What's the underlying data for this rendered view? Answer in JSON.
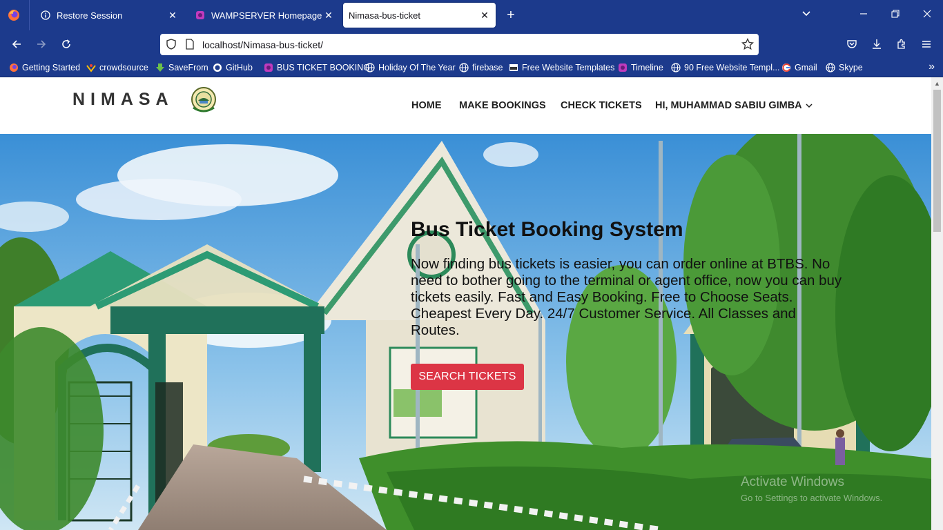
{
  "browser": {
    "tabs": [
      {
        "title": "Restore Session",
        "icon": "info-icon"
      },
      {
        "title": "WAMPSERVER Homepage",
        "icon": "wamp-icon"
      },
      {
        "title": "Nimasa-bus-ticket",
        "icon": "none"
      }
    ],
    "url": "localhost/Nimasa-bus-ticket/",
    "bookmarks": [
      {
        "label": "Getting Started",
        "icon": "firefox-icon"
      },
      {
        "label": "crowdsource",
        "icon": "crowdsource-icon"
      },
      {
        "label": "SaveFrom",
        "icon": "download-arrow-icon"
      },
      {
        "label": "GitHub",
        "icon": "github-icon"
      },
      {
        "label": "BUS TICKET BOOKING",
        "icon": "wamp-icon"
      },
      {
        "label": "Holiday Of The Year",
        "icon": "globe-icon"
      },
      {
        "label": "firebase",
        "icon": "globe-icon"
      },
      {
        "label": "Free Website Templates",
        "icon": "ost-icon"
      },
      {
        "label": "Timeline",
        "icon": "wamp-icon"
      },
      {
        "label": "90 Free Website Templ...",
        "icon": "globe-icon"
      },
      {
        "label": "Gmail",
        "icon": "google-icon"
      },
      {
        "label": "Skype",
        "icon": "globe-icon"
      }
    ]
  },
  "site": {
    "brand": "NIMASA",
    "menu": {
      "home": "HOME",
      "make_bookings": "MAKE BOOKINGS",
      "check_tickets": "CHECK TICKETS",
      "user": "HI, MUHAMMAD SABIU GIMBA"
    },
    "hero": {
      "title": "Bus Ticket Booking System",
      "description": "Now finding bus tickets is easier, you can order online at BTBS. No need to bother going to the terminal or agent office, now you can buy tickets easily. Fast and Easy Booking. Free to Choose Seats. Cheapest Every Day. 24/7 Customer Service. All Classes and Routes.",
      "button": "SEARCH TICKETS"
    },
    "watermark": {
      "line1": "Activate Windows",
      "line2": "Go to Settings to activate Windows."
    }
  },
  "colors": {
    "browser_chrome": "#1c3a8c",
    "button_red": "#dc3545"
  }
}
